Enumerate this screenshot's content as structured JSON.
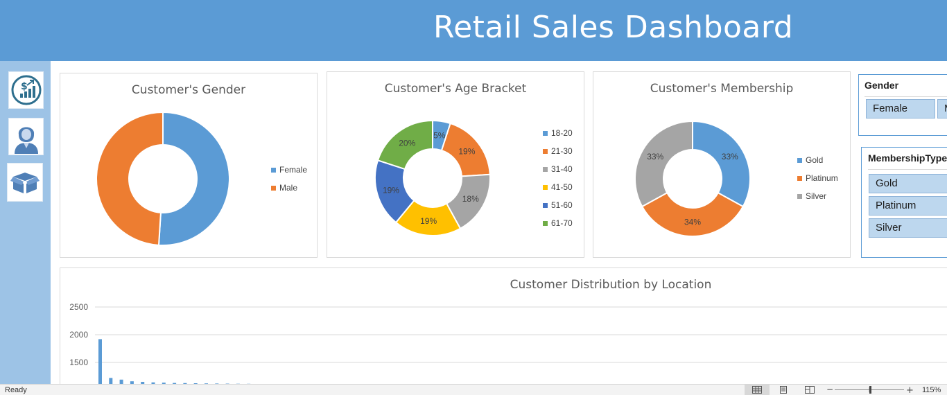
{
  "header": {
    "title": "Retail Sales Dashboard"
  },
  "nav": [
    {
      "icon": "sales-growth-icon"
    },
    {
      "icon": "customer-icon"
    },
    {
      "icon": "product-box-icon"
    }
  ],
  "charts": {
    "gender": {
      "title": "Customer's Gender",
      "legend": [
        "Female",
        "Male"
      ]
    },
    "age": {
      "title": "Customer's Age Bracket",
      "legend": [
        "18-20",
        "21-30",
        "31-40",
        "41-50",
        "51-60",
        "61-70"
      ]
    },
    "membership": {
      "title": "Customer's Membership",
      "legend": [
        "Gold",
        "Platinum",
        "Silver"
      ]
    },
    "location": {
      "title": "Customer Distribution by Location",
      "yticks": [
        "2500",
        "2000",
        "1500"
      ]
    }
  },
  "chart_data": [
    {
      "type": "pie",
      "title": "Customer's Gender",
      "categories": [
        "Female",
        "Male"
      ],
      "values": [
        51,
        49
      ],
      "colors": [
        "#5b9bd5",
        "#ed7d31"
      ]
    },
    {
      "type": "pie",
      "title": "Customer's Age Bracket",
      "categories": [
        "18-20",
        "21-30",
        "31-40",
        "41-50",
        "51-60",
        "61-70"
      ],
      "values": [
        5,
        19,
        18,
        19,
        19,
        20
      ],
      "labels": [
        "5%",
        "19%",
        "18%",
        "19%",
        "19%",
        "20%"
      ],
      "colors": [
        "#5b9bd5",
        "#ed7d31",
        "#a5a5a5",
        "#ffc000",
        "#4472c4",
        "#70ad47"
      ]
    },
    {
      "type": "pie",
      "title": "Customer's Membership",
      "categories": [
        "Gold",
        "Platinum",
        "Silver"
      ],
      "values": [
        33,
        34,
        33
      ],
      "labels": [
        "33%",
        "34%",
        "33%"
      ],
      "colors": [
        "#5b9bd5",
        "#ed7d31",
        "#a5a5a5"
      ]
    },
    {
      "type": "bar",
      "title": "Customer Distribution by Location",
      "values": [
        1920,
        1220,
        1190,
        1160,
        1150,
        1140,
        1135,
        1130,
        1128,
        1125,
        1122,
        1120,
        1118,
        1116,
        1115
      ],
      "ylim": [
        1100,
        2500
      ],
      "yticks": [
        1500,
        2000,
        2500
      ],
      "color": "#5b9bd5",
      "grid": true
    }
  ],
  "slicers": {
    "gender": {
      "title": "Gender",
      "items": [
        "Female",
        "Male"
      ]
    },
    "membership": {
      "title": "MembershipType",
      "items": [
        "Gold",
        "Platinum",
        "Silver"
      ]
    }
  },
  "status": {
    "ready": "Ready",
    "zoom": "115%"
  }
}
